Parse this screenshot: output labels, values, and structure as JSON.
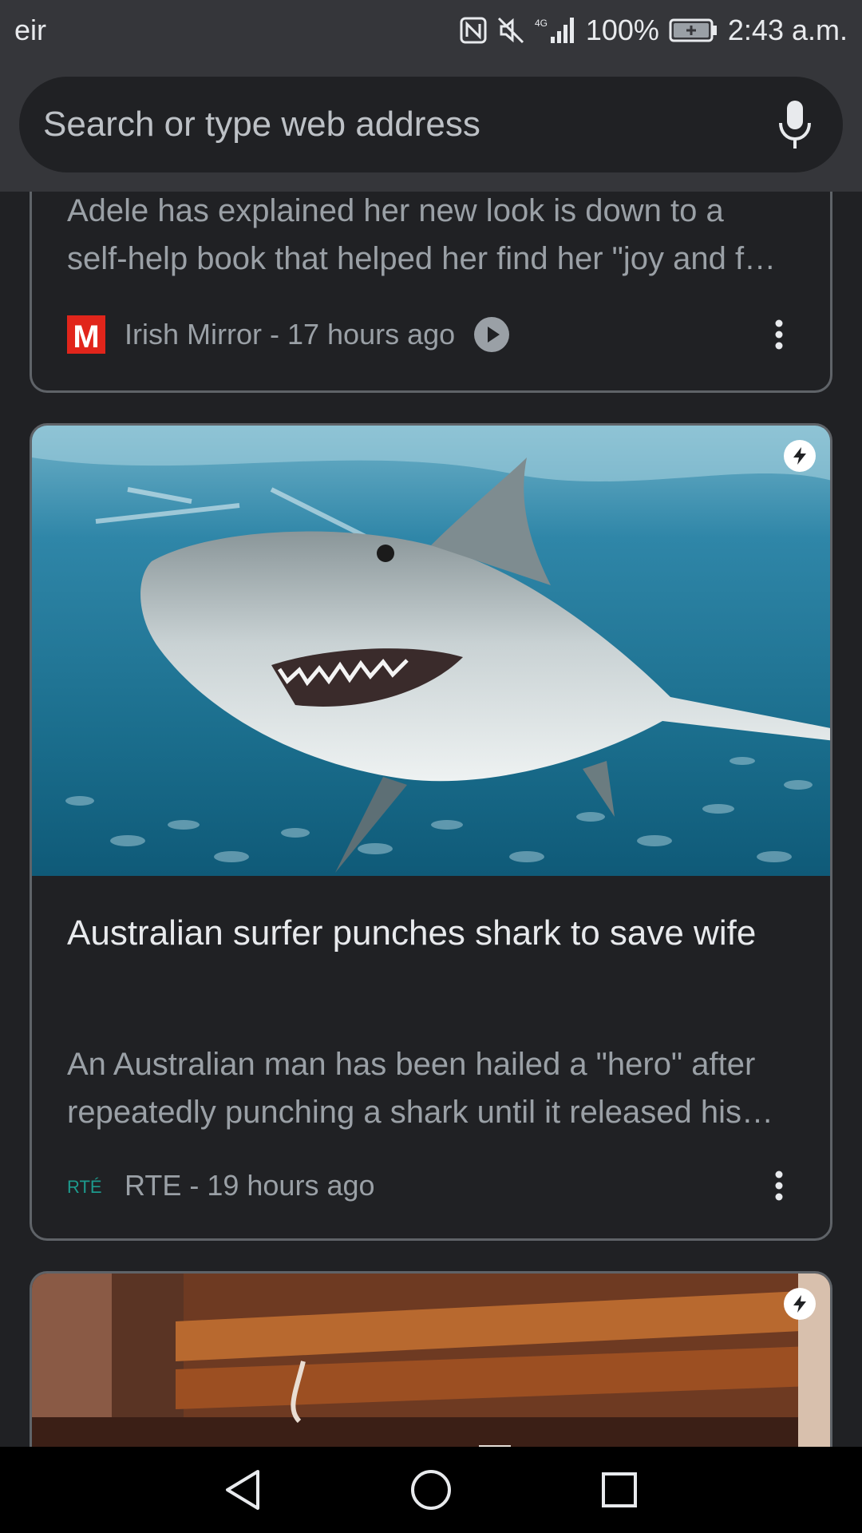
{
  "status_bar": {
    "carrier": "eir",
    "network_type": "4G",
    "battery": "100%",
    "time": "2:43 a.m."
  },
  "omnibox": {
    "placeholder": "Search or type web address"
  },
  "cards": [
    {
      "snippet_lines": [
        "Adele has explained her new look is down to a",
        "self-help book that helped her find her \"joy and f…"
      ],
      "source": "Irish Mirror - 17 hours ago",
      "source_logo_text": "M",
      "has_video": true
    },
    {
      "headline": "Australian surfer punches shark to save wife",
      "snippet_lines": [
        "An Australian man has been hailed a \"hero\" after",
        "repeatedly punching a shark until it released his…"
      ],
      "source": "RTE - 19 hours ago",
      "source_logo_text": "RTÉ",
      "image": "shark-underwater-photo"
    },
    {
      "image": "dim-room-photo"
    }
  ],
  "colors": {
    "background": "#202124",
    "toolbar": "#35363a",
    "card_border": "#5f6368",
    "mirror_red": "#e1251b",
    "rte_teal": "#1d9a8d"
  },
  "icons": [
    "nfc-icon",
    "mute-icon",
    "signal-icon",
    "battery-icon",
    "mic-icon",
    "play-icon",
    "more-vert-icon",
    "amp-bolt-icon",
    "back-icon",
    "home-icon",
    "recents-icon"
  ]
}
